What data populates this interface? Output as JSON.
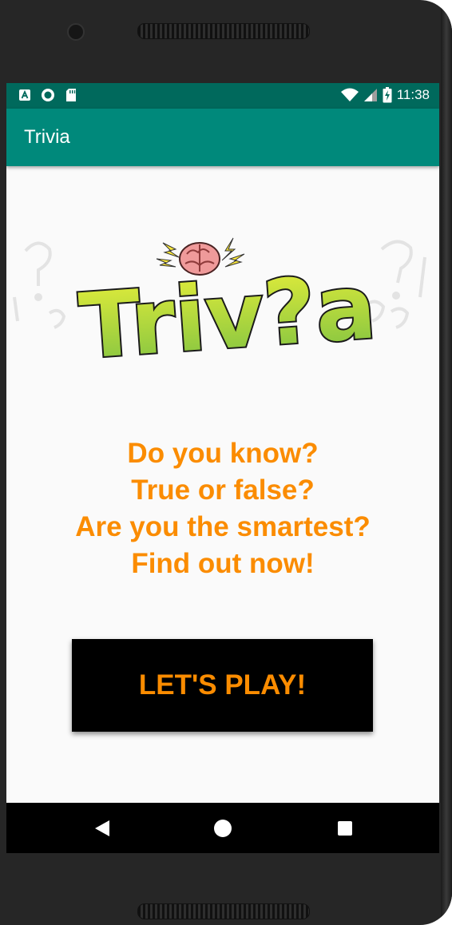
{
  "status_bar": {
    "time": "11:38",
    "left_icons": [
      "a-icon",
      "circle-record-icon",
      "sd-card-icon"
    ],
    "right_icons": [
      "wifi-icon",
      "signal-icon",
      "battery-charging-icon"
    ]
  },
  "app_bar": {
    "title": "Trivia"
  },
  "logo": {
    "text": "Triv?a",
    "icon": "brain-icon"
  },
  "tagline": {
    "lines": [
      "Do you know?",
      "True or false?",
      "Are you the smartest?",
      "Find out now!"
    ]
  },
  "play_button": {
    "label": "LET'S PLAY!"
  },
  "nav_bar": {
    "buttons": [
      "back-icon",
      "home-icon",
      "recents-icon"
    ]
  },
  "colors": {
    "status_bar": "#00695c",
    "app_bar": "#00897b",
    "accent_orange": "#fb8c00",
    "logo_green": "#8bc34a",
    "logo_yellow": "#d4e157"
  }
}
